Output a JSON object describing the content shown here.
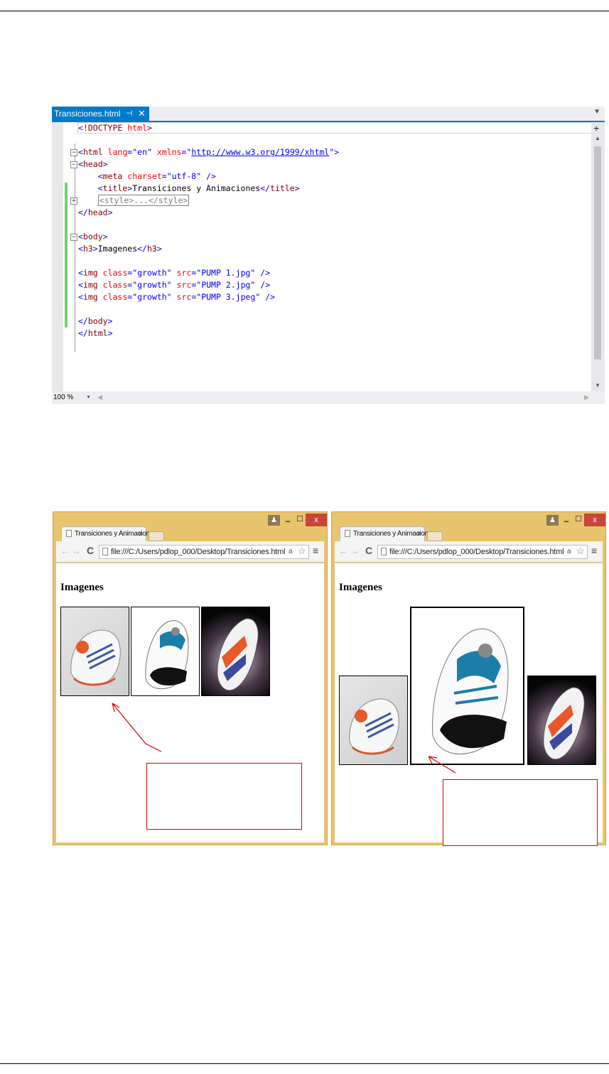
{
  "editor": {
    "tab_title": "Transiciones.html",
    "pin_glyph": "⊣",
    "close_glyph": "✕",
    "zoom": "100 %",
    "code_lines": [
      [
        {
          "c": "t-br",
          "t": "<"
        },
        {
          "c": "t-tag",
          "t": "!DOCTYPE "
        },
        {
          "c": "t-attr",
          "t": "html"
        },
        {
          "c": "t-br",
          "t": ">"
        }
      ],
      [],
      [
        {
          "c": "t-br",
          "t": "<"
        },
        {
          "c": "t-tag",
          "t": "html"
        },
        {
          "c": "",
          "t": " "
        },
        {
          "c": "t-attr",
          "t": "lang"
        },
        {
          "c": "t-br",
          "t": "="
        },
        {
          "c": "t-val",
          "t": "\"en\""
        },
        {
          "c": "",
          "t": " "
        },
        {
          "c": "t-attr",
          "t": "xmlns"
        },
        {
          "c": "t-br",
          "t": "="
        },
        {
          "c": "t-val",
          "t": "\""
        },
        {
          "c": "t-link",
          "t": "http://www.w3.org/1999/xhtml"
        },
        {
          "c": "t-val",
          "t": "\""
        },
        {
          "c": "t-br",
          "t": ">"
        }
      ],
      [
        {
          "c": "t-br",
          "t": "<"
        },
        {
          "c": "t-tag",
          "t": "head"
        },
        {
          "c": "t-br",
          "t": ">"
        }
      ],
      [
        {
          "c": "",
          "t": "    "
        },
        {
          "c": "t-br",
          "t": "<"
        },
        {
          "c": "t-tag",
          "t": "meta"
        },
        {
          "c": "",
          "t": " "
        },
        {
          "c": "t-attr",
          "t": "charset"
        },
        {
          "c": "t-br",
          "t": "="
        },
        {
          "c": "t-val",
          "t": "\"utf-8\""
        },
        {
          "c": "",
          "t": " "
        },
        {
          "c": "t-br",
          "t": "/>"
        }
      ],
      [
        {
          "c": "",
          "t": "    "
        },
        {
          "c": "t-br",
          "t": "<"
        },
        {
          "c": "t-tag",
          "t": "title"
        },
        {
          "c": "t-br",
          "t": ">"
        },
        {
          "c": "",
          "t": "Transiciones y Animaciones"
        },
        {
          "c": "t-br",
          "t": "</"
        },
        {
          "c": "t-tag",
          "t": "title"
        },
        {
          "c": "t-br",
          "t": ">"
        }
      ],
      [
        {
          "c": "",
          "t": "    "
        },
        {
          "c": "collapsed-box",
          "t": "<style>...</style>"
        }
      ],
      [
        {
          "c": "t-br",
          "t": "</"
        },
        {
          "c": "t-tag",
          "t": "head"
        },
        {
          "c": "t-br",
          "t": ">"
        }
      ],
      [],
      [
        {
          "c": "t-br",
          "t": "<"
        },
        {
          "c": "t-tag",
          "t": "body"
        },
        {
          "c": "t-br",
          "t": ">"
        }
      ],
      [
        {
          "c": "t-br",
          "t": "<"
        },
        {
          "c": "t-tag",
          "t": "h3"
        },
        {
          "c": "t-br",
          "t": ">"
        },
        {
          "c": "",
          "t": "Imagenes"
        },
        {
          "c": "t-br",
          "t": "</"
        },
        {
          "c": "t-tag",
          "t": "h3"
        },
        {
          "c": "t-br",
          "t": ">"
        }
      ],
      [],
      [
        {
          "c": "t-br",
          "t": "<"
        },
        {
          "c": "t-tag",
          "t": "img"
        },
        {
          "c": "",
          "t": " "
        },
        {
          "c": "t-attr",
          "t": "class"
        },
        {
          "c": "t-br",
          "t": "="
        },
        {
          "c": "t-val",
          "t": "\"growth\""
        },
        {
          "c": "",
          "t": " "
        },
        {
          "c": "t-attr",
          "t": "src"
        },
        {
          "c": "t-br",
          "t": "="
        },
        {
          "c": "t-val",
          "t": "\"PUMP 1.jpg\""
        },
        {
          "c": "",
          "t": " "
        },
        {
          "c": "t-br",
          "t": "/>"
        }
      ],
      [
        {
          "c": "t-br",
          "t": "<"
        },
        {
          "c": "t-tag",
          "t": "img"
        },
        {
          "c": "",
          "t": " "
        },
        {
          "c": "t-attr",
          "t": "class"
        },
        {
          "c": "t-br",
          "t": "="
        },
        {
          "c": "t-val",
          "t": "\"growth\""
        },
        {
          "c": "",
          "t": " "
        },
        {
          "c": "t-attr",
          "t": "src"
        },
        {
          "c": "t-br",
          "t": "="
        },
        {
          "c": "t-val",
          "t": "\"PUMP 2.jpg\""
        },
        {
          "c": "",
          "t": " "
        },
        {
          "c": "t-br",
          "t": "/>"
        }
      ],
      [
        {
          "c": "t-br",
          "t": "<"
        },
        {
          "c": "t-tag",
          "t": "img"
        },
        {
          "c": "",
          "t": " "
        },
        {
          "c": "t-attr",
          "t": "class"
        },
        {
          "c": "t-br",
          "t": "="
        },
        {
          "c": "t-val",
          "t": "\"growth\""
        },
        {
          "c": "",
          "t": " "
        },
        {
          "c": "t-attr",
          "t": "src"
        },
        {
          "c": "t-br",
          "t": "="
        },
        {
          "c": "t-val",
          "t": "\"PUMP 3.jpeg\""
        },
        {
          "c": "",
          "t": " "
        },
        {
          "c": "t-br",
          "t": "/>"
        }
      ],
      [],
      [
        {
          "c": "t-br",
          "t": "</"
        },
        {
          "c": "t-tag",
          "t": "body"
        },
        {
          "c": "t-br",
          "t": ">"
        }
      ],
      [
        {
          "c": "t-br",
          "t": "</"
        },
        {
          "c": "t-tag",
          "t": "html"
        },
        {
          "c": "t-br",
          "t": ">"
        }
      ]
    ]
  },
  "browser": {
    "tab_title": "Transiciones y Animacion",
    "tab_close": "x",
    "url": "file:///C:/Users/pdlop_000/Desktop/Transiciones.html",
    "back_glyph": "←",
    "forward_glyph": "→",
    "reload_glyph": "C",
    "menu_glyph": "≡",
    "star_glyph": "☆",
    "translate_glyph": "a",
    "min_glyph": "‗",
    "max_glyph": "☐",
    "close_glyph": "x",
    "user_glyph": "♟",
    "heading": "Imagenes"
  },
  "images": [
    "PUMP 1.jpg",
    "PUMP 2.jpg",
    "PUMP 3.jpeg"
  ],
  "colors": {
    "accent": "#007acc",
    "window_frame": "#e9c46e",
    "annotation": "#dd0000",
    "change_bar": "#6fd26a"
  }
}
